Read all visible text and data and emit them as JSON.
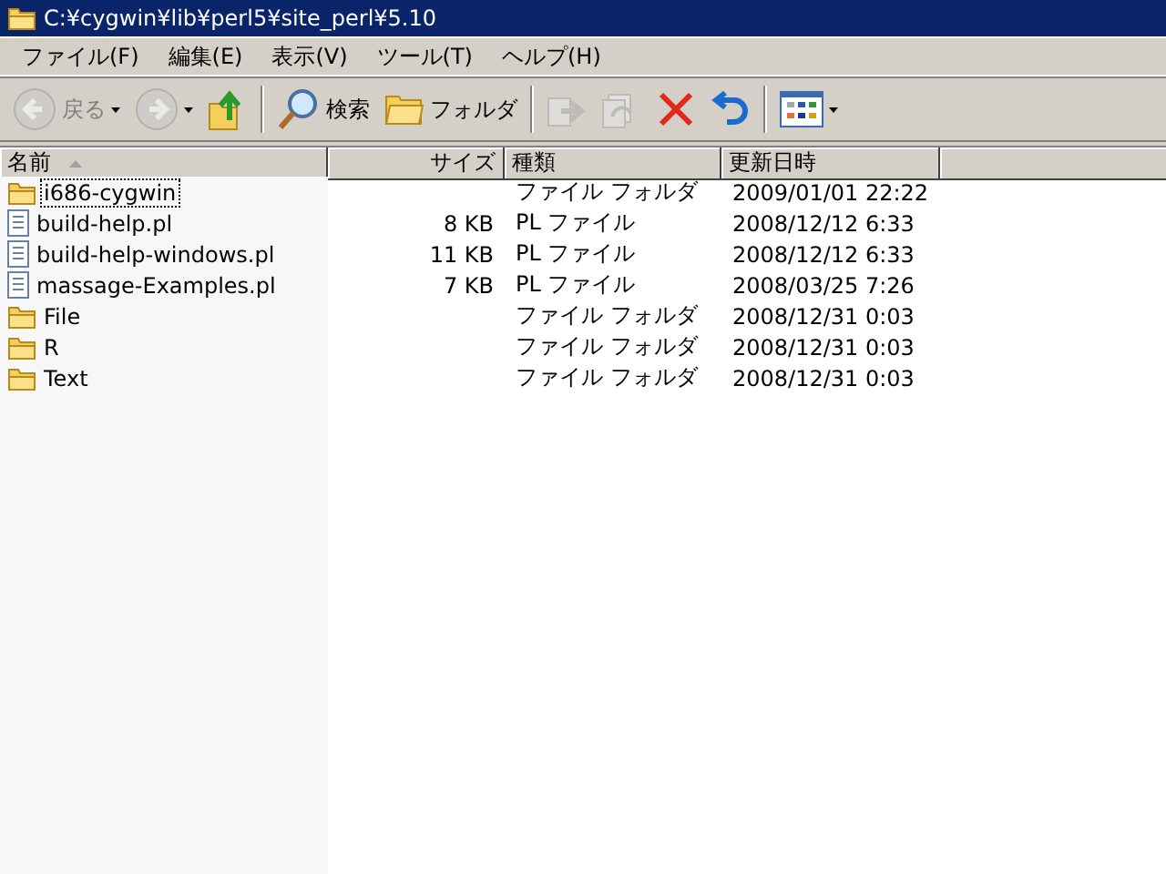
{
  "window": {
    "title": "C:¥cygwin¥lib¥perl5¥site_perl¥5.10"
  },
  "menu": [
    "ファイル(F)",
    "編集(E)",
    "表示(V)",
    "ツール(T)",
    "ヘルプ(H)"
  ],
  "toolbar": [
    {
      "kind": "back",
      "label": "戻る",
      "disabled": true,
      "dropdown": true
    },
    {
      "kind": "forward",
      "disabled": true,
      "dropdown": true
    },
    {
      "kind": "up",
      "disabled": false
    },
    {
      "kind": "separator"
    },
    {
      "kind": "search",
      "label": "検索",
      "disabled": false
    },
    {
      "kind": "folders",
      "label": "フォルダ",
      "disabled": false
    },
    {
      "kind": "separator"
    },
    {
      "kind": "move",
      "disabled": true
    },
    {
      "kind": "copy",
      "disabled": true
    },
    {
      "kind": "delete",
      "disabled": false
    },
    {
      "kind": "undo",
      "disabled": false
    },
    {
      "kind": "separator"
    },
    {
      "kind": "views",
      "disabled": false,
      "dropdown": true
    }
  ],
  "table": {
    "columns": [
      {
        "label": "名前",
        "sorted": true
      },
      {
        "label": "サイズ",
        "sorted": false
      },
      {
        "label": "種類",
        "sorted": false
      },
      {
        "label": "更新日時",
        "sorted": false
      }
    ],
    "rows": [
      {
        "kind": "folder",
        "name": "i686-cygwin",
        "type": "ファイル フォルダ",
        "modified": "2009/01/01 22:22",
        "focused": true
      },
      {
        "kind": "file",
        "name": "build-help.pl",
        "size": "8 KB",
        "type": "PL ファイル",
        "modified": "2008/12/12 6:33",
        "focused": false
      },
      {
        "kind": "file",
        "name": "build-help-windows.pl",
        "size": "11 KB",
        "type": "PL ファイル",
        "modified": "2008/12/12 6:33",
        "focused": false
      },
      {
        "kind": "file",
        "name": "massage-Examples.pl",
        "size": "7 KB",
        "type": "PL ファイル",
        "modified": "2008/03/25 7:26",
        "focused": false
      },
      {
        "kind": "folder",
        "name": "File",
        "type": "ファイル フォルダ",
        "modified": "2008/12/31 0:03",
        "focused": false
      },
      {
        "kind": "folder",
        "name": "R",
        "type": "ファイル フォルダ",
        "modified": "2008/12/31 0:03",
        "focused": false
      },
      {
        "kind": "folder",
        "name": "Text",
        "type": "ファイル フォルダ",
        "modified": "2008/12/31 0:03",
        "focused": false
      }
    ]
  }
}
